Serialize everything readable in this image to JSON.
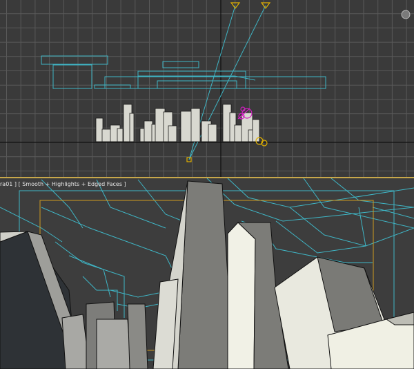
{
  "viewports": {
    "top": {
      "name": "top-viewport"
    },
    "camera": {
      "label": "ra01 ] [ Smooth + Highlights + Edged Faces ]"
    }
  },
  "colors": {
    "grid": "#595959",
    "axis": "#101010",
    "wireframe": "#3fb6c6",
    "building_fill": "#d8d8d0",
    "building_edge": "#111111",
    "camera_target": "#e0b000",
    "selected": "#d020c0",
    "safe_frame_outer": "#3fb6c6",
    "safe_frame_inner": "#d09a20",
    "divider": "#c8a84a"
  }
}
